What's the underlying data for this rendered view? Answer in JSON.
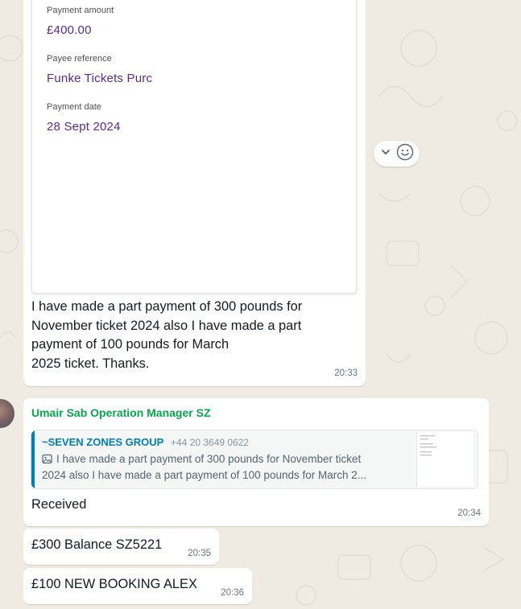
{
  "messages": [
    {
      "receipt": {
        "amount_label": "Payment amount",
        "amount": "£400.00",
        "reference_label": "Payee reference",
        "reference": "Funke Tickets Purc",
        "date_label": "Payment date",
        "date": "28 Sept 2024"
      },
      "text_lines": [
        "I have made a part payment of  300 pounds for",
        "November  ticket 2024 also I have  made a part",
        "payment of 100 pounds  for March",
        "2025  ticket. Thanks."
      ],
      "time": "20:33"
    },
    {
      "sender": "Umair Sab Operation Manager SZ",
      "quote": {
        "author": "~SEVEN ZONES GROUP",
        "phone": "+44 20 3649 0622",
        "text_line1": "I have made a part payment of  300 pounds for  November  ticket",
        "text_line2": "2024 also I have  made a part payment of 100 pounds  for March 2...",
        "icon": "image-icon"
      },
      "text": "Received",
      "time": "20:34"
    },
    {
      "text": "£300 Balance SZ5221",
      "time": "20:35"
    },
    {
      "text": "£100 NEW BOOKING ALEX",
      "time": "20:36"
    }
  ],
  "reaction_controls": {
    "icons": [
      "chevron-down-icon",
      "emoji-icon"
    ]
  },
  "colors": {
    "chat_background": "#efeae2",
    "bubble": "#ffffff",
    "sender_name": "#06a74f",
    "quote_author": "#027eb5",
    "receipt_text": "#5b2a86",
    "timestamp": "#667781"
  }
}
